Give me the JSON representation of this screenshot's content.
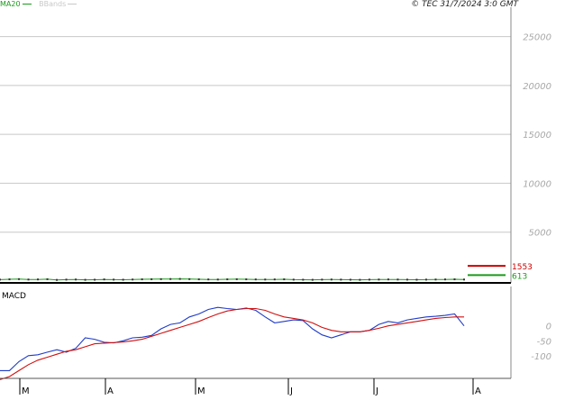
{
  "header": {
    "legend_ma": "MA20",
    "legend_bbands": "BBands",
    "copyright": "© TEC 31/7/2024 3:0 GMT"
  },
  "colors": {
    "price": "#1a9a1a",
    "signal_red": "#cc0000",
    "macd_blue": "#1f3cc8",
    "macd_red": "#d01010",
    "grid": "#c8c8c8",
    "axis_text": "#a8a8a8"
  },
  "chart_data": [
    {
      "type": "line",
      "panel": "price",
      "ylim": [
        0,
        28000
      ],
      "y_ticks": [
        5000,
        10000,
        15000,
        20000,
        25000
      ],
      "y_tick_labels": [
        "5000",
        "10000",
        "15000",
        "20000",
        "25000"
      ],
      "x_ticks": [
        "M",
        "A",
        "M",
        "J",
        "J",
        "A"
      ],
      "grid": true,
      "series": [
        {
          "values": [
            150,
            180,
            200,
            160,
            170,
            190,
            120,
            150,
            160,
            130,
            140,
            170,
            150,
            140,
            160,
            180,
            190,
            200,
            210,
            220,
            200,
            180,
            170,
            160,
            180,
            190,
            180,
            170,
            160,
            170,
            180,
            150,
            140,
            130,
            150,
            160,
            150,
            140,
            130,
            150,
            160,
            170,
            160,
            150,
            140,
            150,
            160,
            170,
            180,
            160
          ]
        }
      ],
      "markers": [
        {
          "label": "1553",
          "value": 1553,
          "color": "#cc0000"
        },
        {
          "label": "613",
          "value": 613,
          "color": "#1a9a1a"
        }
      ]
    },
    {
      "type": "line",
      "panel": "macd",
      "title": "MACD",
      "ylim": [
        -170,
        120
      ],
      "y_ticks": [
        0,
        -50,
        -100
      ],
      "y_tick_labels": [
        "0",
        "-50",
        "-100"
      ],
      "series": [
        {
          "values": [
            -150,
            -150,
            -120,
            -100,
            -97,
            -88,
            -80,
            -88,
            -75,
            -40,
            -45,
            -55,
            -57,
            -50,
            -40,
            -38,
            -32,
            -10,
            5,
            10,
            30,
            40,
            55,
            62,
            58,
            55,
            60,
            52,
            30,
            10,
            15,
            20,
            18,
            -10,
            -30,
            -40,
            -30,
            -20,
            -20,
            -15,
            5,
            15,
            10,
            20,
            25,
            30,
            32,
            35,
            40,
            0
          ],
          "color": "#1f3cc8"
        },
        {
          "values": [
            -180,
            -170,
            -150,
            -130,
            -115,
            -105,
            -95,
            -85,
            -80,
            -70,
            -60,
            -58,
            -56,
            -54,
            -50,
            -45,
            -35,
            -25,
            -15,
            -5,
            5,
            15,
            28,
            40,
            50,
            55,
            58,
            58,
            52,
            40,
            30,
            25,
            20,
            10,
            -5,
            -15,
            -20,
            -20,
            -20,
            -15,
            -8,
            0,
            5,
            10,
            15,
            20,
            25,
            28,
            30,
            30
          ],
          "color": "#d01010"
        }
      ]
    }
  ]
}
